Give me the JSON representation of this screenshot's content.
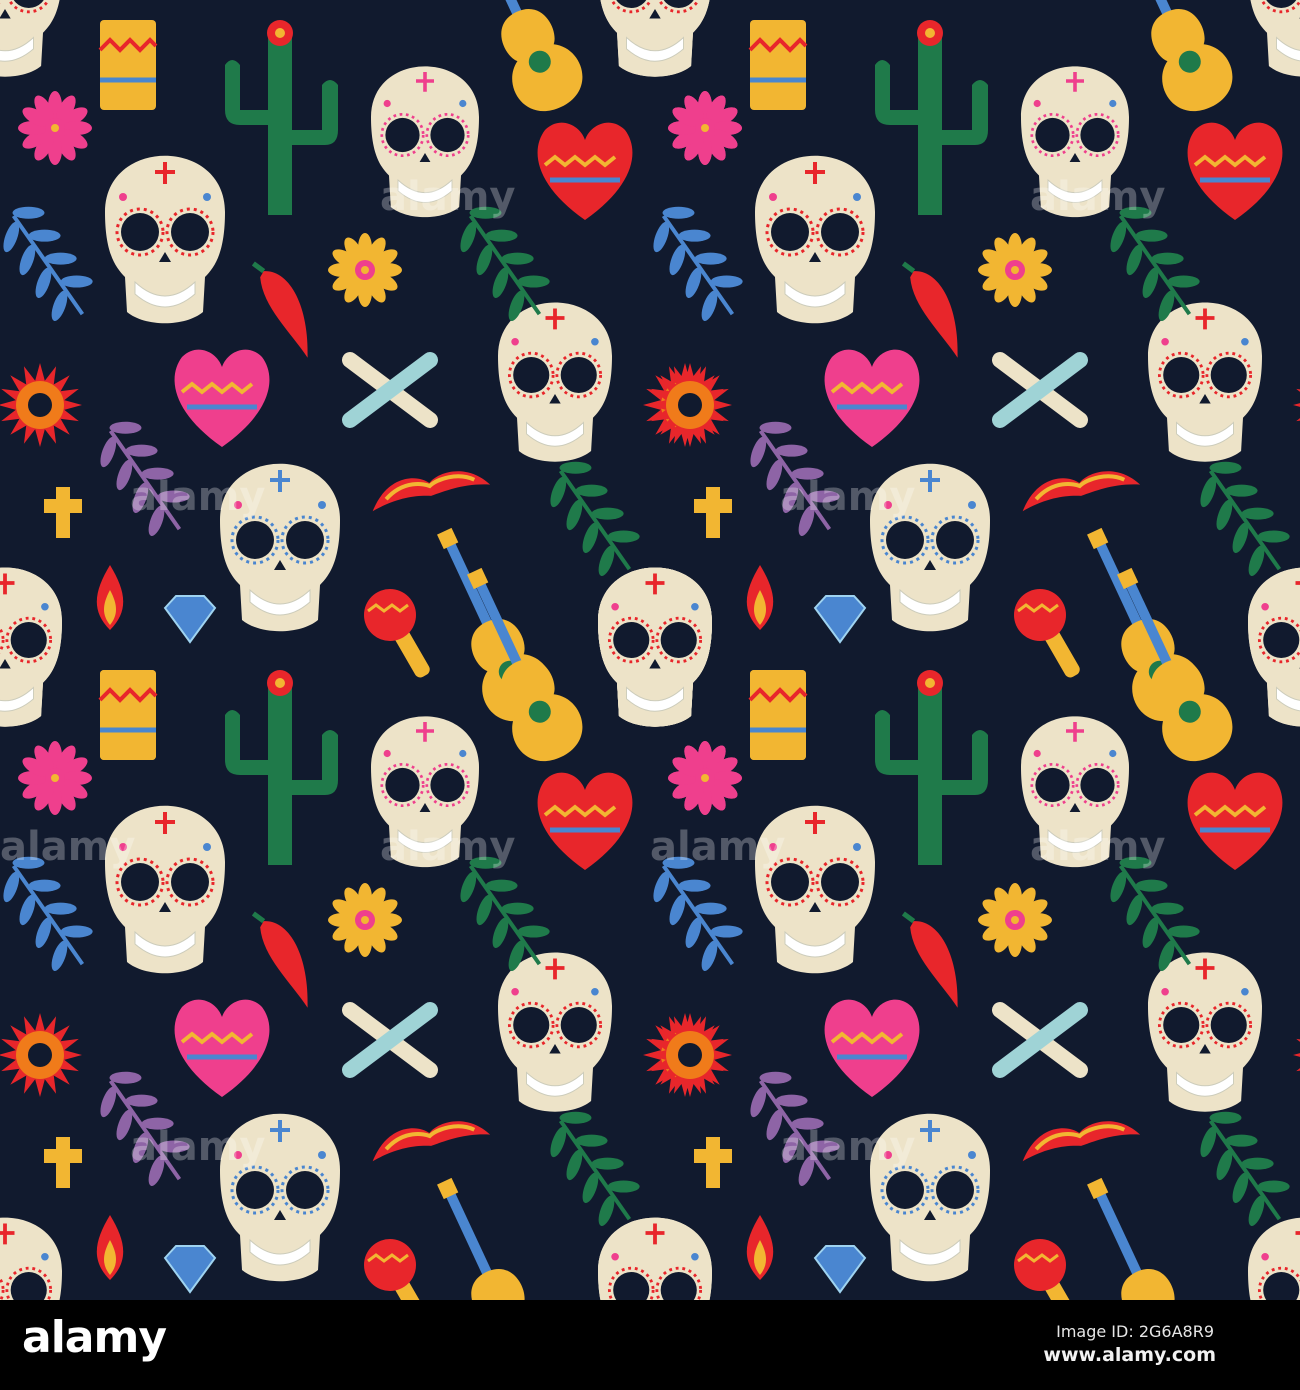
{
  "artwork": {
    "background_color": "#111a2e",
    "motifs": [
      "sugar-skull",
      "cactus",
      "guitar",
      "candle",
      "heart",
      "flower",
      "crossed-bones",
      "chili-pepper",
      "leaf-branch",
      "cross",
      "mustache",
      "diamond",
      "maraca"
    ],
    "palette": {
      "skull": "#ede3c8",
      "red": "#e8262b",
      "pink": "#ef3f8d",
      "yellow": "#f2b632",
      "green": "#1f7a4a",
      "blue": "#4a86d0",
      "purple": "#8e64a6"
    },
    "watermark": "alamy"
  },
  "footer": {
    "logo": "alamy",
    "image_id": "Image ID: 2G6A8R9",
    "website": "www.alamy.com"
  }
}
